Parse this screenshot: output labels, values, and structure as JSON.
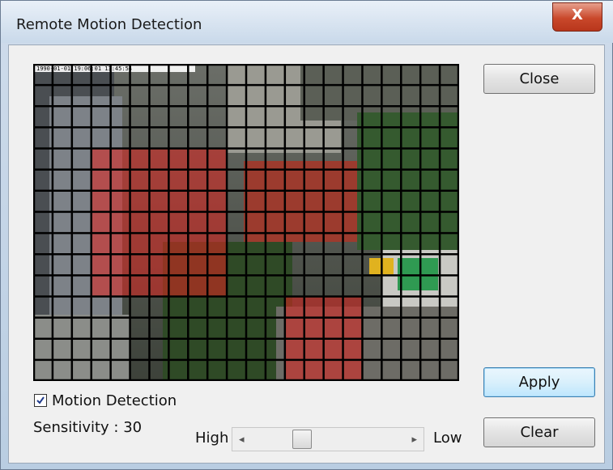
{
  "window": {
    "title": "Remote Motion Detection",
    "close_glyph": "X"
  },
  "buttons": {
    "close": "Close",
    "apply": "Apply",
    "clear": "Clear"
  },
  "video": {
    "timestamp": "1990-01-01   19:06:01   13:45:54",
    "grid": {
      "cols": 22,
      "rows": 15
    },
    "active_regions": [
      {
        "col_start": 3,
        "col_end": 10,
        "row_start": 4,
        "row_end": 11
      },
      {
        "col_start": 13,
        "col_end": 17,
        "row_start": 11,
        "row_end": 15
      }
    ],
    "highlight_color": "#e0241f"
  },
  "motion_detection": {
    "label": "Motion Detection",
    "checked": true
  },
  "sensitivity": {
    "label": "Sensitivity : 30",
    "value": 30,
    "high_label": "High",
    "low_label": "Low",
    "left_arrow": "◂",
    "right_arrow": "▸"
  },
  "icons": {
    "checkbox": "checkmark-icon",
    "slider_left": "arrow-left-icon",
    "slider_right": "arrow-right-icon"
  }
}
